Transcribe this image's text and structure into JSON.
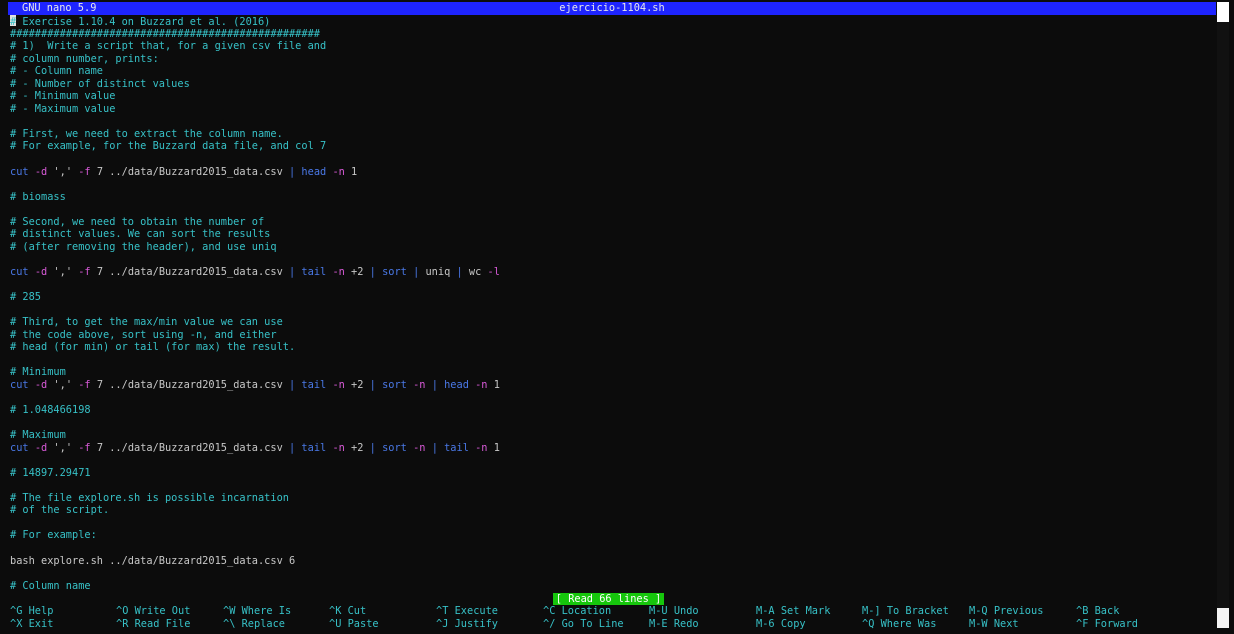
{
  "window": {
    "app_title": "GNU nano 5.9",
    "file_name": "ejercicio-1104.sh"
  },
  "colors": {
    "titlebar": "#1e24ff",
    "comment": "#37c1c7",
    "keyword": "#4a78e6",
    "flag": "#d85ad8",
    "status": "#16c60c"
  },
  "editor": {
    "lines": [
      [
        {
          "c": "cmt",
          "t": "# Exercise 1.10.4 on Buzzard et al. (2016)"
        }
      ],
      [
        {
          "c": "cmt",
          "t": "##################################################"
        }
      ],
      [
        {
          "c": "cmt",
          "t": "# 1)  Write a script that, for a given csv file and"
        }
      ],
      [
        {
          "c": "cmt",
          "t": "# column number, prints:"
        }
      ],
      [
        {
          "c": "cmt",
          "t": "# - Column name"
        }
      ],
      [
        {
          "c": "cmt",
          "t": "# - Number of distinct values"
        }
      ],
      [
        {
          "c": "cmt",
          "t": "# - Minimum value"
        }
      ],
      [
        {
          "c": "cmt",
          "t": "# - Maximum value"
        }
      ],
      [],
      [
        {
          "c": "cmt",
          "t": "# First, we need to extract the column name."
        }
      ],
      [
        {
          "c": "cmt",
          "t": "# For example, for the Buzzard data file, and col 7"
        }
      ],
      [],
      [
        {
          "c": "kw",
          "t": "cut"
        },
        {
          "c": "plain",
          "t": " "
        },
        {
          "c": "flag",
          "t": "-d"
        },
        {
          "c": "plain",
          "t": " ',' "
        },
        {
          "c": "flag",
          "t": "-f"
        },
        {
          "c": "plain",
          "t": " 7 ../data/Buzzard2015_data.csv "
        },
        {
          "c": "kw",
          "t": "|"
        },
        {
          "c": "plain",
          "t": " "
        },
        {
          "c": "kw",
          "t": "head"
        },
        {
          "c": "plain",
          "t": " "
        },
        {
          "c": "flag",
          "t": "-n"
        },
        {
          "c": "plain",
          "t": " 1"
        }
      ],
      [],
      [
        {
          "c": "cmt",
          "t": "# biomass"
        }
      ],
      [],
      [
        {
          "c": "cmt",
          "t": "# Second, we need to obtain the number of"
        }
      ],
      [
        {
          "c": "cmt",
          "t": "# distinct values. We can sort the results"
        }
      ],
      [
        {
          "c": "cmt",
          "t": "# (after removing the header), and use uniq"
        }
      ],
      [],
      [
        {
          "c": "kw",
          "t": "cut"
        },
        {
          "c": "plain",
          "t": " "
        },
        {
          "c": "flag",
          "t": "-d"
        },
        {
          "c": "plain",
          "t": " ',' "
        },
        {
          "c": "flag",
          "t": "-f"
        },
        {
          "c": "plain",
          "t": " 7 ../data/Buzzard2015_data.csv "
        },
        {
          "c": "kw",
          "t": "|"
        },
        {
          "c": "plain",
          "t": " "
        },
        {
          "c": "kw",
          "t": "tail"
        },
        {
          "c": "plain",
          "t": " "
        },
        {
          "c": "flag",
          "t": "-n"
        },
        {
          "c": "plain",
          "t": " +2 "
        },
        {
          "c": "kw",
          "t": "|"
        },
        {
          "c": "plain",
          "t": " "
        },
        {
          "c": "kw",
          "t": "sort"
        },
        {
          "c": "plain",
          "t": " "
        },
        {
          "c": "kw",
          "t": "|"
        },
        {
          "c": "plain",
          "t": " uniq "
        },
        {
          "c": "kw",
          "t": "|"
        },
        {
          "c": "plain",
          "t": " wc "
        },
        {
          "c": "flag",
          "t": "-l"
        }
      ],
      [],
      [
        {
          "c": "cmt",
          "t": "# 285"
        }
      ],
      [],
      [
        {
          "c": "cmt",
          "t": "# Third, to get the max/min value we can use"
        }
      ],
      [
        {
          "c": "cmt",
          "t": "# the code above, sort using -n, and either"
        }
      ],
      [
        {
          "c": "cmt",
          "t": "# head (for min) or tail (for max) the result."
        }
      ],
      [],
      [
        {
          "c": "cmt",
          "t": "# Minimum"
        }
      ],
      [
        {
          "c": "kw",
          "t": "cut"
        },
        {
          "c": "plain",
          "t": " "
        },
        {
          "c": "flag",
          "t": "-d"
        },
        {
          "c": "plain",
          "t": " ',' "
        },
        {
          "c": "flag",
          "t": "-f"
        },
        {
          "c": "plain",
          "t": " 7 ../data/Buzzard2015_data.csv "
        },
        {
          "c": "kw",
          "t": "|"
        },
        {
          "c": "plain",
          "t": " "
        },
        {
          "c": "kw",
          "t": "tail"
        },
        {
          "c": "plain",
          "t": " "
        },
        {
          "c": "flag",
          "t": "-n"
        },
        {
          "c": "plain",
          "t": " +2 "
        },
        {
          "c": "kw",
          "t": "|"
        },
        {
          "c": "plain",
          "t": " "
        },
        {
          "c": "kw",
          "t": "sort"
        },
        {
          "c": "plain",
          "t": " "
        },
        {
          "c": "flag",
          "t": "-n"
        },
        {
          "c": "plain",
          "t": " "
        },
        {
          "c": "kw",
          "t": "|"
        },
        {
          "c": "plain",
          "t": " "
        },
        {
          "c": "kw",
          "t": "head"
        },
        {
          "c": "plain",
          "t": " "
        },
        {
          "c": "flag",
          "t": "-n"
        },
        {
          "c": "plain",
          "t": " 1"
        }
      ],
      [],
      [
        {
          "c": "cmt",
          "t": "# 1.048466198"
        }
      ],
      [],
      [
        {
          "c": "cmt",
          "t": "# Maximum"
        }
      ],
      [
        {
          "c": "kw",
          "t": "cut"
        },
        {
          "c": "plain",
          "t": " "
        },
        {
          "c": "flag",
          "t": "-d"
        },
        {
          "c": "plain",
          "t": " ',' "
        },
        {
          "c": "flag",
          "t": "-f"
        },
        {
          "c": "plain",
          "t": " 7 ../data/Buzzard2015_data.csv "
        },
        {
          "c": "kw",
          "t": "|"
        },
        {
          "c": "plain",
          "t": " "
        },
        {
          "c": "kw",
          "t": "tail"
        },
        {
          "c": "plain",
          "t": " "
        },
        {
          "c": "flag",
          "t": "-n"
        },
        {
          "c": "plain",
          "t": " +2 "
        },
        {
          "c": "kw",
          "t": "|"
        },
        {
          "c": "plain",
          "t": " "
        },
        {
          "c": "kw",
          "t": "sort"
        },
        {
          "c": "plain",
          "t": " "
        },
        {
          "c": "flag",
          "t": "-n"
        },
        {
          "c": "plain",
          "t": " "
        },
        {
          "c": "kw",
          "t": "|"
        },
        {
          "c": "plain",
          "t": " "
        },
        {
          "c": "kw",
          "t": "tail"
        },
        {
          "c": "plain",
          "t": " "
        },
        {
          "c": "flag",
          "t": "-n"
        },
        {
          "c": "plain",
          "t": " 1"
        }
      ],
      [],
      [
        {
          "c": "cmt",
          "t": "# 14897.29471"
        }
      ],
      [],
      [
        {
          "c": "cmt",
          "t": "# The file explore.sh is possible incarnation"
        }
      ],
      [
        {
          "c": "cmt",
          "t": "# of the script."
        }
      ],
      [],
      [
        {
          "c": "cmt",
          "t": "# For example:"
        }
      ],
      [],
      [
        {
          "c": "plain",
          "t": "bash explore.sh ../data/Buzzard2015_data.csv 6"
        }
      ],
      [],
      [
        {
          "c": "cmt",
          "t": "# Column name"
        }
      ]
    ]
  },
  "status": {
    "message": "[ Read 66 lines ]"
  },
  "shortcuts": [
    {
      "key": "^G",
      "label": "Help"
    },
    {
      "key": "^X",
      "label": "Exit"
    },
    {
      "key": "^O",
      "label": "Write Out"
    },
    {
      "key": "^R",
      "label": "Read File"
    },
    {
      "key": "^W",
      "label": "Where Is"
    },
    {
      "key": "^\\",
      "label": "Replace"
    },
    {
      "key": "^K",
      "label": "Cut"
    },
    {
      "key": "^U",
      "label": "Paste"
    },
    {
      "key": "^T",
      "label": "Execute"
    },
    {
      "key": "^J",
      "label": "Justify"
    },
    {
      "key": "^C",
      "label": "Location"
    },
    {
      "key": "^/",
      "label": "Go To Line"
    },
    {
      "key": "M-U",
      "label": "Undo"
    },
    {
      "key": "M-E",
      "label": "Redo"
    },
    {
      "key": "M-A",
      "label": "Set Mark"
    },
    {
      "key": "M-6",
      "label": "Copy"
    },
    {
      "key": "M-]",
      "label": "To Bracket"
    },
    {
      "key": "^Q",
      "label": "Where Was"
    },
    {
      "key": "M-Q",
      "label": "Previous"
    },
    {
      "key": "M-W",
      "label": "Next"
    },
    {
      "key": "^B",
      "label": "Back"
    },
    {
      "key": "^F",
      "label": "Forward"
    }
  ]
}
